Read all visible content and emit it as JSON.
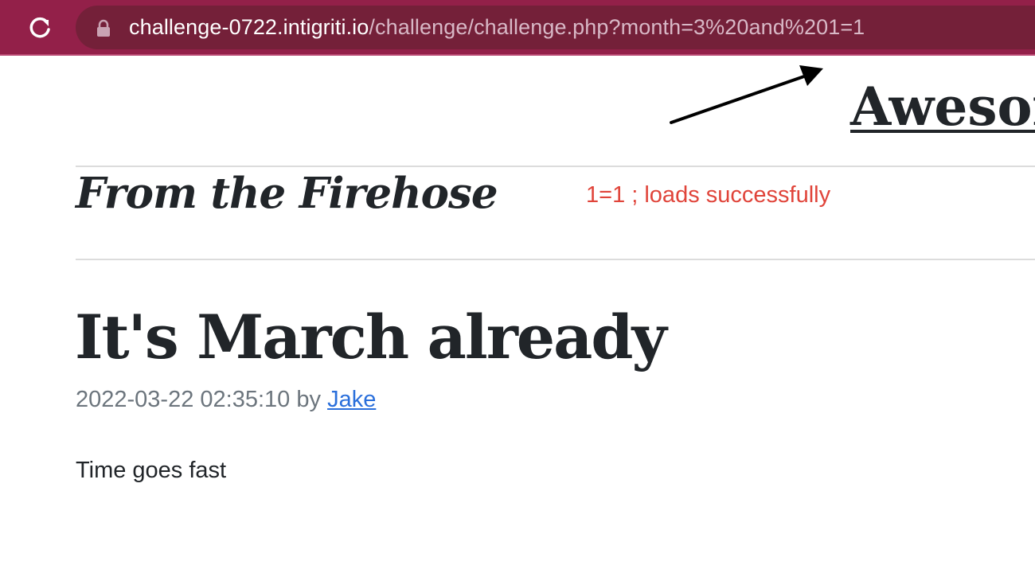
{
  "browser": {
    "url_host": "challenge-0722.intigriti.io",
    "url_path": "/challenge/challenge.php?month=3%20and%201=1",
    "toolbar_color": "#932049",
    "urlbar_color": "#742039"
  },
  "page": {
    "site_title": "Awesor",
    "section_title": "From the Firehose",
    "annotation": "1=1 ; loads successfully",
    "post": {
      "title": "It's March already",
      "date": "2022-03-22 02:35:10",
      "by": "by",
      "author": "Jake",
      "body": "Time goes fast"
    }
  },
  "colors": {
    "annotation": "#e0443a",
    "link": "#2a6fdb",
    "text": "#212529",
    "muted": "#6c757d"
  }
}
